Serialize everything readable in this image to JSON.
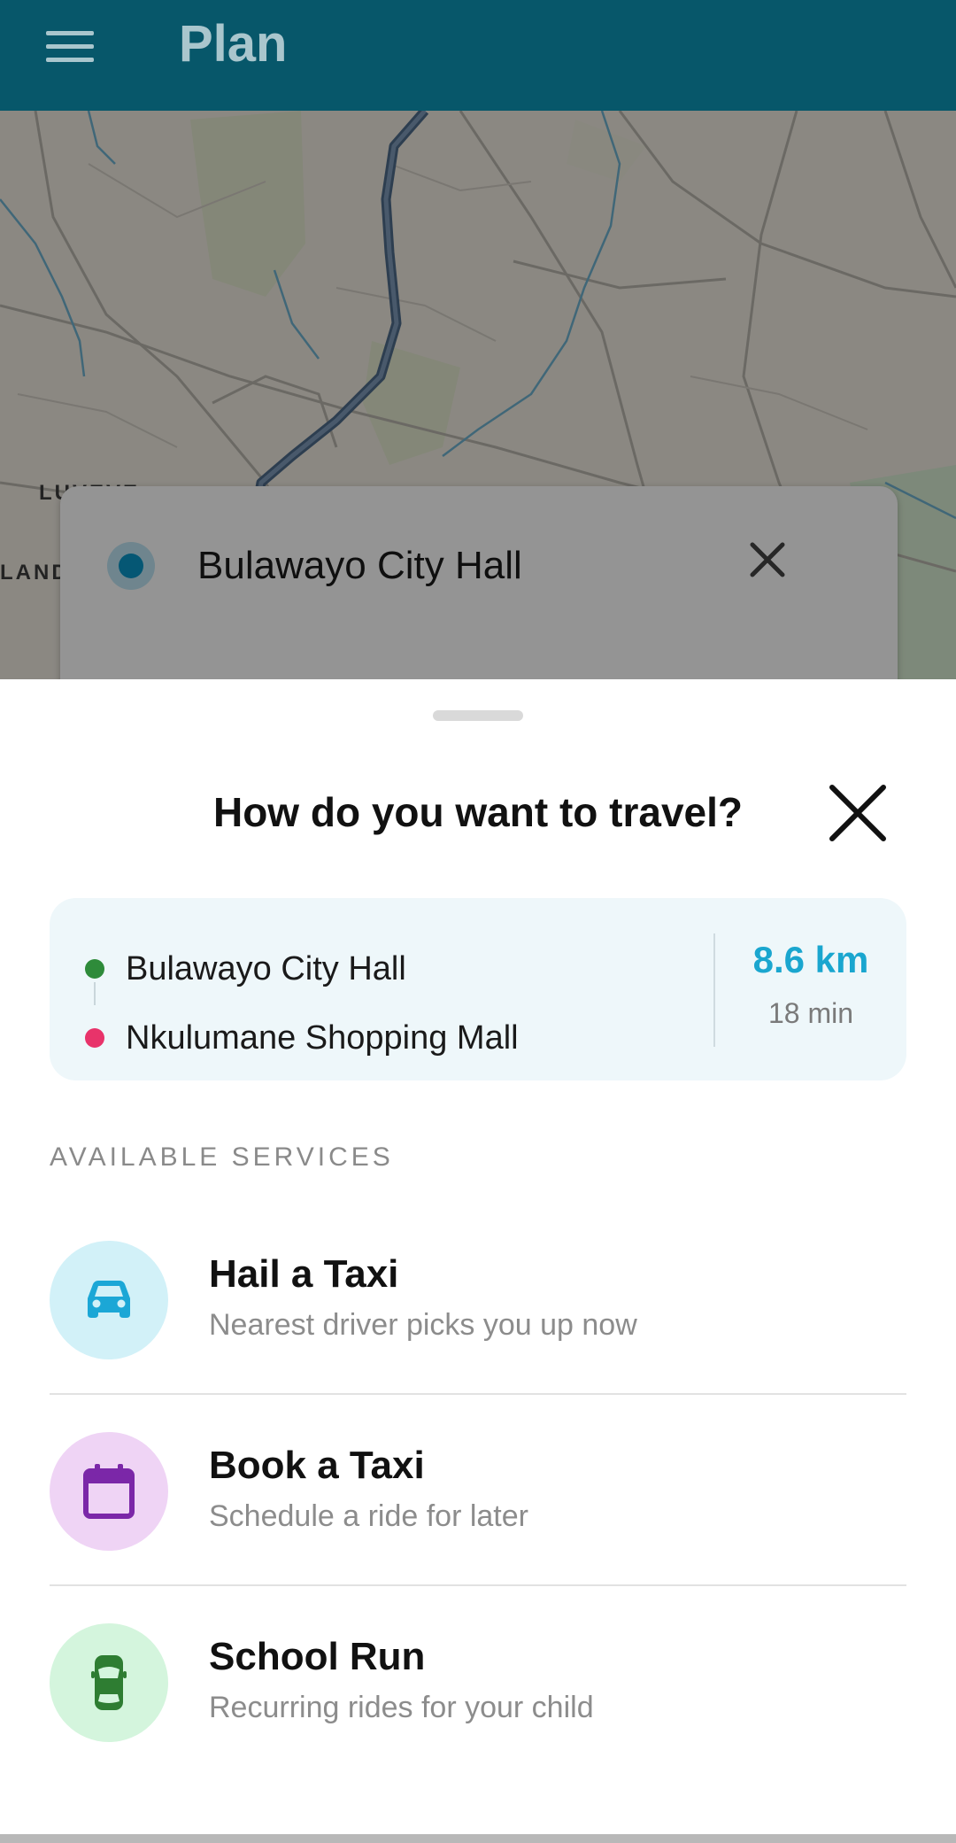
{
  "appbar": {
    "title": "Plan",
    "menu_icon": "hamburger-menu-icon",
    "background": "#07576a"
  },
  "map": {
    "labels": [
      "LUVEVE",
      "LAND"
    ],
    "search_origin": "Bulawayo City Hall",
    "clear_icon": "close-icon"
  },
  "sheet": {
    "title": "How do you want to travel?",
    "close_icon": "close-icon",
    "route": {
      "origin": "Bulawayo City Hall",
      "origin_color": "#2e8b3a",
      "destination": "Nkulumane Shopping Mall",
      "destination_color": "#e8336a",
      "distance": "8.6 km",
      "duration": "18 min",
      "distance_color": "#1aa6cf"
    },
    "section_label": "AVAILABLE SERVICES",
    "services": [
      {
        "title": "Hail a Taxi",
        "subtitle": "Nearest driver picks you up now",
        "icon": "car-icon",
        "icon_color": "#1ba7d6",
        "bg_color": "#d2f1f8"
      },
      {
        "title": "Book a Taxi",
        "subtitle": "Schedule a ride for later",
        "icon": "calendar-icon",
        "icon_color": "#7b27a8",
        "bg_color": "#efd4f5"
      },
      {
        "title": "School Run",
        "subtitle": "Recurring rides for your child",
        "icon": "car-top-icon",
        "icon_color": "#2e7d32",
        "bg_color": "#d4f5dd"
      }
    ]
  }
}
